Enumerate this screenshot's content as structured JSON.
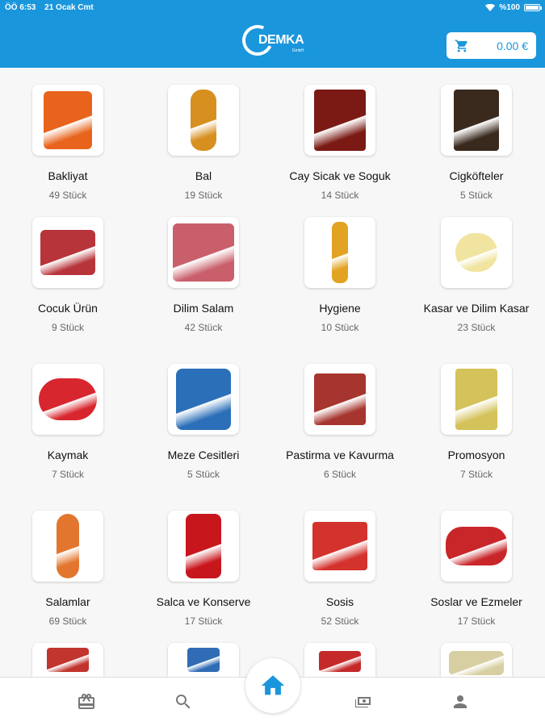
{
  "status": {
    "time": "ÖÖ 6:53",
    "date": "21 Ocak Cmt",
    "battery": "%100"
  },
  "header": {
    "logo_text": "DEMKA",
    "logo_sub": "GmbH",
    "cart_amount": "0.00 €"
  },
  "categories": [
    {
      "name": "Bakliyat",
      "count": "49 Stück",
      "color": "#e8641c"
    },
    {
      "name": "Bal",
      "count": "19 Stück",
      "color": "#d7901f"
    },
    {
      "name": "Cay Sicak ve Soguk",
      "count": "14 Stück",
      "color": "#7b1a14"
    },
    {
      "name": "Cigköfteler",
      "count": "5 Stück",
      "color": "#3a2a1e"
    },
    {
      "name": "Cocuk Ürün",
      "count": "9 Stück",
      "color": "#b7343a"
    },
    {
      "name": "Dilim Salam",
      "count": "42 Stück",
      "color": "#c95f6a"
    },
    {
      "name": "Hygiene",
      "count": "10 Stück",
      "color": "#e3a322"
    },
    {
      "name": "Kasar ve Dilim Kasar",
      "count": "23 Stück",
      "color": "#f1e4a0"
    },
    {
      "name": "Kaymak",
      "count": "7 Stück",
      "color": "#d8262e"
    },
    {
      "name": "Meze Cesitleri",
      "count": "5 Stück",
      "color": "#2b6fb8"
    },
    {
      "name": "Pastirma ve Kavurma",
      "count": "6 Stück",
      "color": "#a5352e"
    },
    {
      "name": "Promosyon",
      "count": "7 Stück",
      "color": "#d4c25a"
    },
    {
      "name": "Salamlar",
      "count": "69 Stück",
      "color": "#e3762e"
    },
    {
      "name": "Salca ve Konserve",
      "count": "17 Stück",
      "color": "#c8161d"
    },
    {
      "name": "Sosis",
      "count": "52 Stück",
      "color": "#d4322c"
    },
    {
      "name": "Soslar ve Ezmeler",
      "count": "17 Stück",
      "color": "#c9262a"
    },
    {
      "name": "",
      "count": "",
      "color": "#c2342e"
    },
    {
      "name": "",
      "count": "",
      "color": "#2f6cb5"
    },
    {
      "name": "",
      "count": "",
      "color": "#c42a2a"
    },
    {
      "name": "",
      "count": "",
      "color": "#d7cfa2"
    }
  ],
  "nav": [
    {
      "icon": "gift-icon"
    },
    {
      "icon": "search-icon"
    },
    {
      "icon": "home-icon"
    },
    {
      "icon": "money-icon"
    },
    {
      "icon": "person-icon"
    }
  ],
  "colors": {
    "accent": "#1a96dc"
  }
}
